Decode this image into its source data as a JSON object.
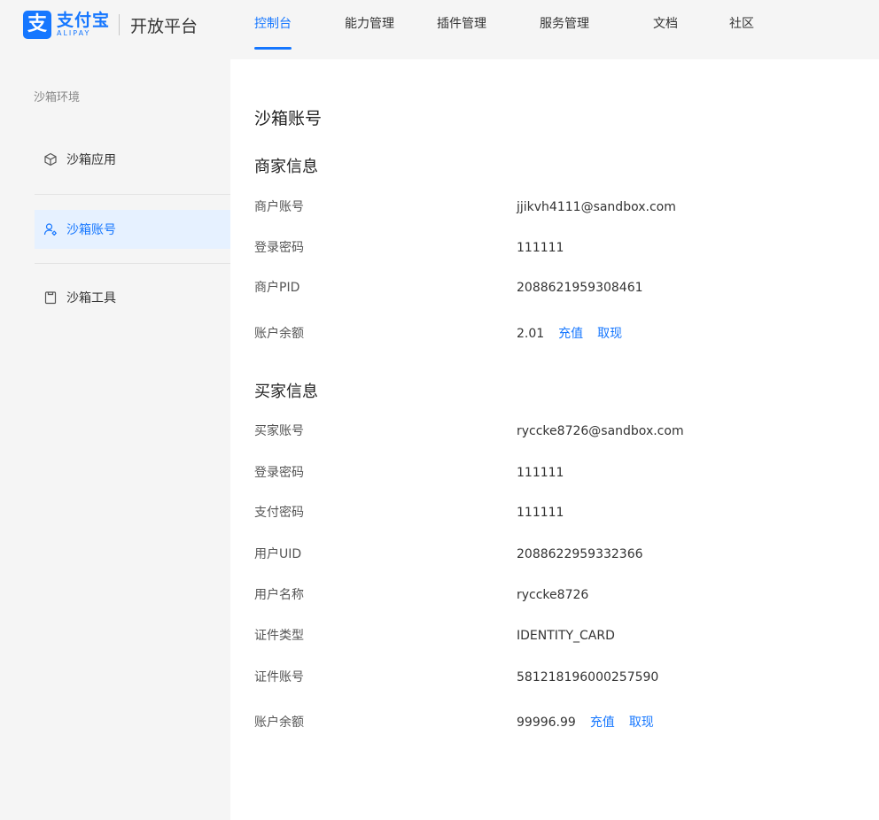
{
  "brand": {
    "mark": "支",
    "name_cn": "支付宝",
    "name_en": "ALIPAY",
    "platform": "开放平台"
  },
  "nav": {
    "items": [
      {
        "label": "控制台",
        "active": true
      },
      {
        "label": "能力管理",
        "active": false
      },
      {
        "label": "插件管理",
        "active": false
      },
      {
        "label": "服务管理",
        "active": false
      },
      {
        "label": "文档",
        "active": false
      },
      {
        "label": "社区",
        "active": false
      }
    ]
  },
  "sidebar": {
    "title": "沙箱环境",
    "items": [
      {
        "label": "沙箱应用",
        "icon": "cube-icon",
        "active": false
      },
      {
        "label": "沙箱账号",
        "icon": "user-settings-icon",
        "active": true
      },
      {
        "label": "沙箱工具",
        "icon": "clipboard-icon",
        "active": false
      }
    ]
  },
  "accent_color": "#1677ff",
  "main": {
    "title": "沙箱账号",
    "merchant": {
      "section_title": "商家信息",
      "rows": [
        {
          "label": "商户账号",
          "value": "jjikvh4111@sandbox.com"
        },
        {
          "label": "登录密码",
          "value": "111111"
        },
        {
          "label": "商户PID",
          "value": "2088621959308461"
        },
        {
          "label": "账户余额",
          "value": "2.01"
        }
      ],
      "actions": {
        "recharge": "充值",
        "withdraw": "取现"
      }
    },
    "buyer": {
      "section_title": "买家信息",
      "rows": [
        {
          "label": "买家账号",
          "value": "ryccke8726@sandbox.com"
        },
        {
          "label": "登录密码",
          "value": "111111"
        },
        {
          "label": "支付密码",
          "value": "111111"
        },
        {
          "label": "用户UID",
          "value": "2088622959332366"
        },
        {
          "label": "用户名称",
          "value": "ryccke8726"
        },
        {
          "label": "证件类型",
          "value": "IDENTITY_CARD"
        },
        {
          "label": "证件账号",
          "value": "581218196000257590"
        },
        {
          "label": "账户余额",
          "value": "99996.99"
        }
      ],
      "actions": {
        "recharge": "充值",
        "withdraw": "取现"
      }
    }
  }
}
